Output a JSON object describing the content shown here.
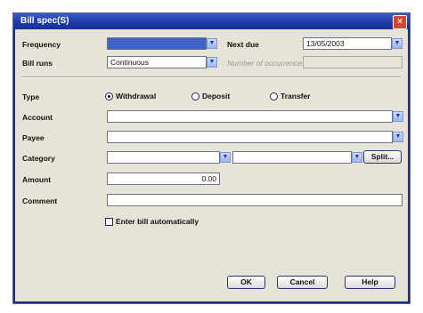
{
  "window": {
    "title": "Bill spec(S)",
    "close_icon": "close-icon"
  },
  "labels": {
    "frequency": "Frequency",
    "next_due": "Next due",
    "bill_runs": "Bill runs",
    "number_of_occurrences": "Number of occurrences",
    "type": "Type",
    "account": "Account",
    "payee": "Payee",
    "category": "Category",
    "amount": "Amount",
    "comment": "Comment"
  },
  "fields": {
    "frequency": "",
    "next_due": "13/05/2003",
    "bill_runs": "Continuous",
    "number_of_occurrences": "",
    "account": "",
    "payee": "",
    "category": "",
    "subcategory": "",
    "amount": "0.00",
    "comment": ""
  },
  "type_options": [
    {
      "label": "Withdrawal",
      "selected": true
    },
    {
      "label": "Deposit",
      "selected": false
    },
    {
      "label": "Transfer",
      "selected": false
    }
  ],
  "split_button": "Split...",
  "enter_automatically": {
    "label": "Enter bill automatically",
    "checked": false
  },
  "buttons": {
    "ok": "OK",
    "cancel": "Cancel",
    "help": "Help"
  },
  "colors": {
    "titlebar": "#1f3aa8",
    "selected_field": "#3f63c9",
    "close": "#d9452b"
  }
}
